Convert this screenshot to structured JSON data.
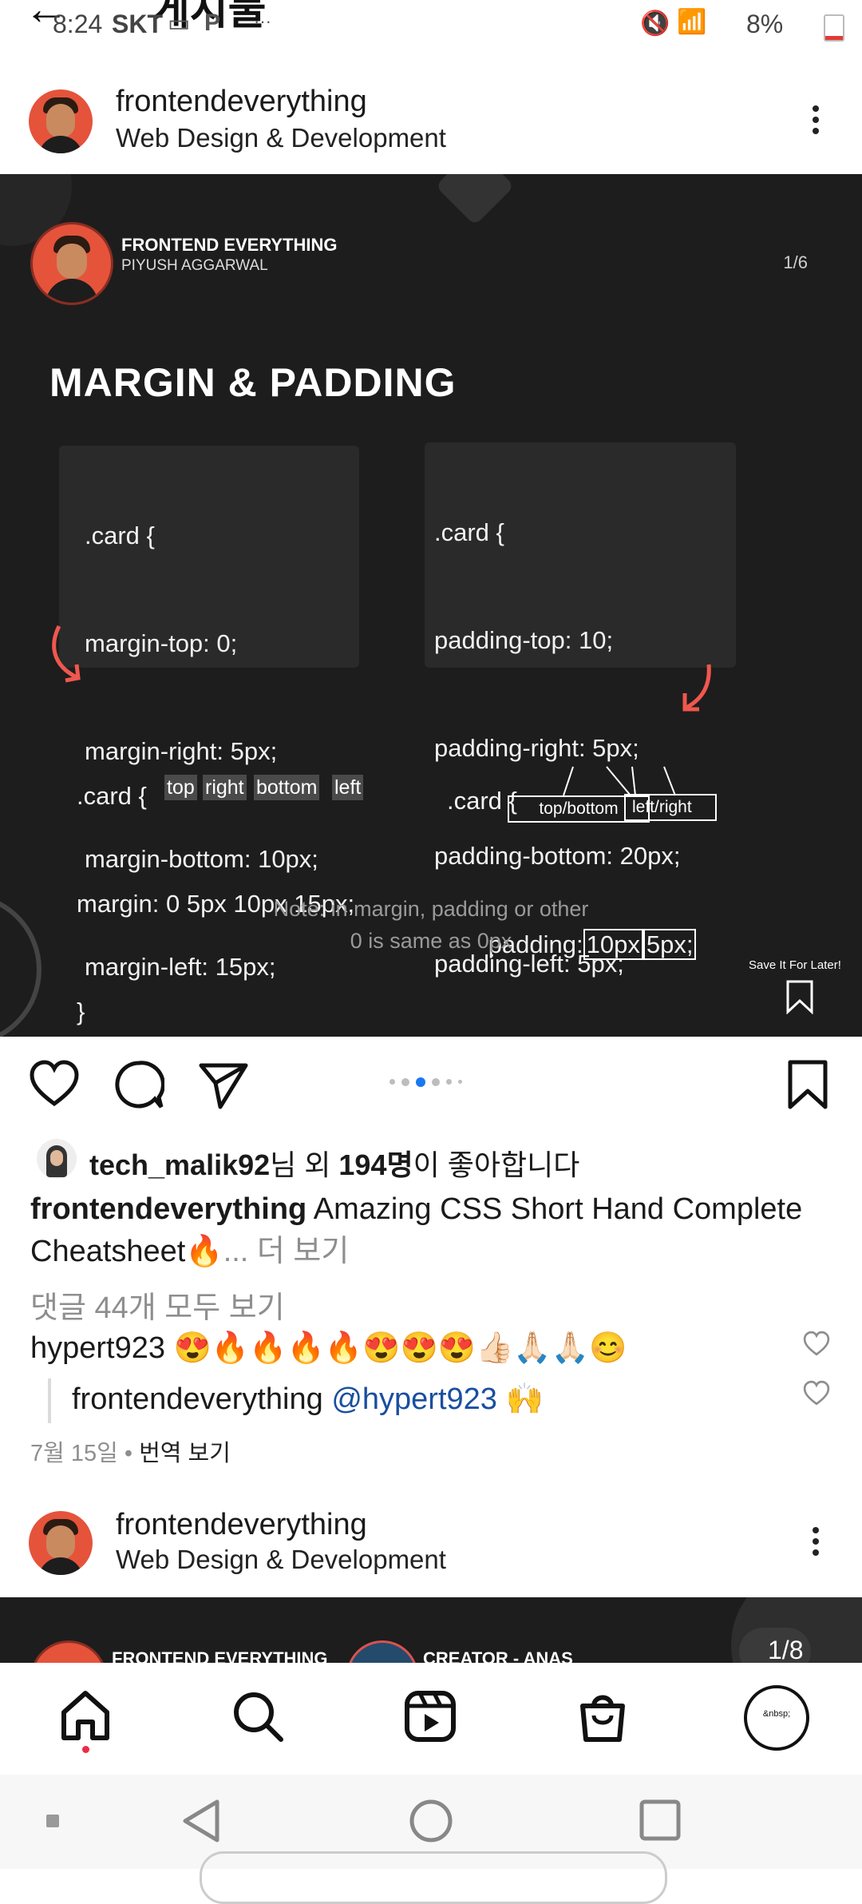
{
  "status_bar": {
    "time": "8:24",
    "carrier": "SKT",
    "battery": "8%",
    "battery_level": 0.08,
    "overflow": "···",
    "header_partial": "게시물"
  },
  "post": {
    "username": "frontendeverything",
    "subtitle": "Web Design & Development",
    "card": {
      "brand": "FRONTEND EVERYTHING",
      "author": "PIYUSH AGGARWAL",
      "page": "1/6",
      "title": "MARGIN & PADDING",
      "margin_code": [
        ".card {",
        "margin-top: 0;",
        "margin-right: 5px;",
        "margin-bottom: 10px;",
        "margin-left: 15px;",
        "}"
      ],
      "padding_code": [
        ".card {",
        "padding-top: 10;",
        "padding-right: 5px;",
        "padding-bottom: 20px;",
        "padding-left: 5px;",
        "}"
      ],
      "margin_short": [
        ".card {",
        "margin: 0 5px 10px 15px;",
        "}"
      ],
      "margin_tags": [
        "top",
        "right",
        "bottom",
        "left"
      ],
      "padding_short_open": ".card {",
      "padding_short_prefix": "padding:",
      "padding_short_val1": "10px",
      "padding_short_val2": "5px;",
      "padding_short_close": "}",
      "padding_tags": [
        "top/bottom",
        "left/right"
      ],
      "note_line1": "Note: in margin, padding or other",
      "note_line2": "0 is same as 0px",
      "save_later": "Save It For Later!"
    },
    "carousel": {
      "count": 6,
      "active_index": 2
    },
    "likes": {
      "user": "tech_malik92",
      "mid": "님 외 ",
      "count": "194명",
      "suffix": "이 좋아합니다"
    },
    "caption": {
      "username": "frontendeverything",
      "text": "Amazing CSS Short Hand Complete Cheatsheet🔥",
      "more": "... 더 보기"
    },
    "comments_link": "댓글 44개 모두 보기",
    "comment1": {
      "username": "hypert923",
      "text": "😍🔥🔥🔥🔥😍😍😍👍🏻🙏🏻🙏🏻😊"
    },
    "reply1": {
      "username": "frontendeverything",
      "mention": "@hypert923",
      "text": "🙌"
    },
    "date": "7월 15일",
    "translate": "번역 보기"
  },
  "next_post": {
    "username": "frontendeverything",
    "subtitle": "Web Design & Development",
    "brand_partial": "FRONTEND EVERYTHING",
    "creator_partial": "CREATOR - ANAS",
    "page": "1/8"
  },
  "bottom_nav": {
    "profile_placeholder": "&nbsp;"
  }
}
